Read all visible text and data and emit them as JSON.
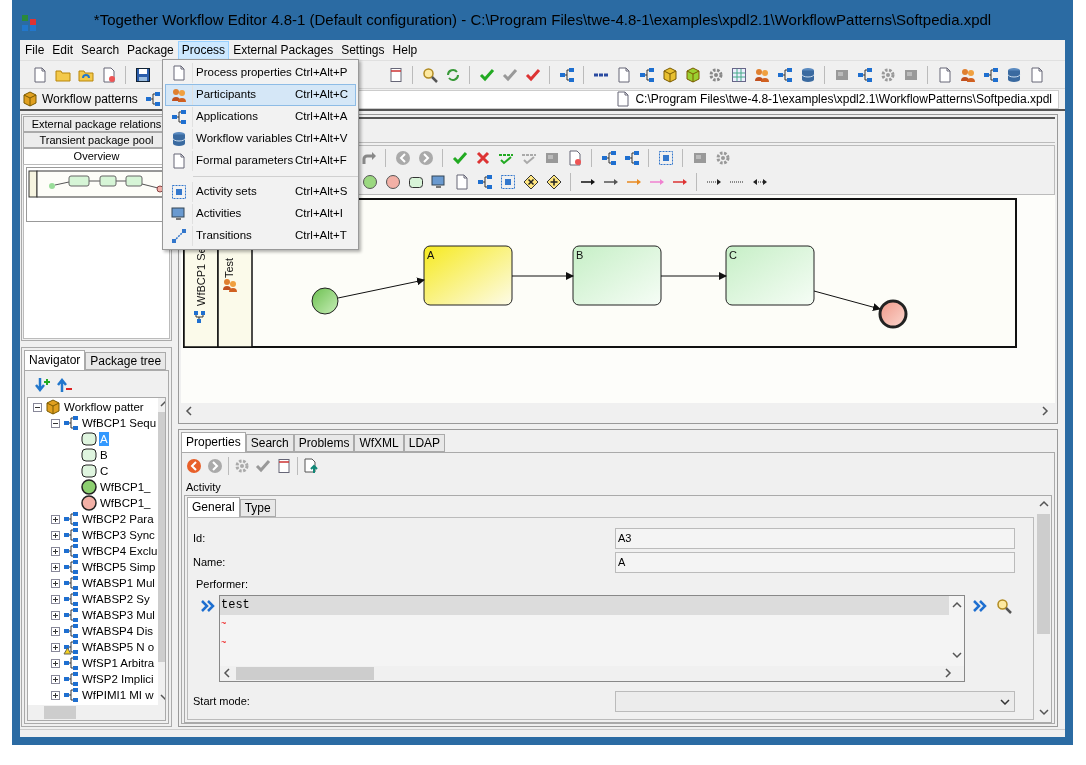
{
  "window": {
    "title": "*Together Workflow Editor 4.8-1 (Default configuration) - C:\\Program Files\\twe-4.8-1\\examples\\xpdl2.1\\WorkflowPatterns\\Softpedia.xpdl"
  },
  "menu_bar": [
    {
      "label": "File",
      "selected": false
    },
    {
      "label": "Edit",
      "selected": false
    },
    {
      "label": "Search",
      "selected": false
    },
    {
      "label": "Package",
      "selected": false
    },
    {
      "label": "Process",
      "selected": true
    },
    {
      "label": "External Packages",
      "selected": false
    },
    {
      "label": "Settings",
      "selected": false
    },
    {
      "label": "Help",
      "selected": false
    }
  ],
  "process_menu": {
    "groups": [
      [
        {
          "label": "Process properties",
          "shortcut": "Ctrl+Alt+P",
          "selected": false
        },
        {
          "label": "Participants",
          "shortcut": "Ctrl+Alt+C",
          "selected": true
        },
        {
          "label": "Applications",
          "shortcut": "Ctrl+Alt+A",
          "selected": false
        },
        {
          "label": "Workflow variables",
          "shortcut": "Ctrl+Alt+V",
          "selected": false
        },
        {
          "label": "Formal parameters",
          "shortcut": "Ctrl+Alt+F",
          "selected": false
        }
      ],
      [
        {
          "label": "Activity sets",
          "shortcut": "Ctrl+Alt+S",
          "selected": false
        },
        {
          "label": "Activities",
          "shortcut": "Ctrl+Alt+I",
          "selected": false
        },
        {
          "label": "Transitions",
          "shortcut": "Ctrl+Alt+T",
          "selected": false
        }
      ]
    ]
  },
  "package_bar": {
    "package": "Workflow patterns",
    "file_path": "C:\\Program Files\\twe-4.8-1\\examples\\xpdl2.1\\WorkflowPatterns\\Softpedia.xpdl"
  },
  "left_tabs": [
    {
      "label": "External package relations",
      "selected": false
    },
    {
      "label": "Transient package pool",
      "selected": false
    },
    {
      "label": "Overview",
      "selected": true
    }
  ],
  "navigator_tabs": [
    {
      "label": "Navigator",
      "selected": true
    },
    {
      "label": "Package tree",
      "selected": false
    }
  ],
  "tree": [
    {
      "label": "Workflow patter",
      "kind": "package",
      "expanded": true,
      "selected": false,
      "children": [
        {
          "label": "WfBCP1 Sequ",
          "kind": "process",
          "expanded": true,
          "selected": false,
          "children": [
            {
              "label": "A",
              "kind": "activity",
              "selected": true
            },
            {
              "label": "B",
              "kind": "activity",
              "selected": false
            },
            {
              "label": "C",
              "kind": "activity",
              "selected": false
            },
            {
              "label": "WfBCP1_",
              "kind": "start",
              "selected": false
            },
            {
              "label": "WfBCP1_",
              "kind": "end",
              "selected": false
            }
          ]
        },
        {
          "label": "WfBCP2 Para",
          "kind": "process",
          "expanded": false,
          "selected": false
        },
        {
          "label": "WfBCP3 Sync",
          "kind": "process",
          "expanded": false,
          "selected": false
        },
        {
          "label": "WfBCP4 Exclu",
          "kind": "process",
          "expanded": false,
          "selected": false
        },
        {
          "label": "WfBCP5 Simp",
          "kind": "process",
          "expanded": false,
          "selected": false
        },
        {
          "label": "WfABSP1 Mul",
          "kind": "process",
          "expanded": false,
          "selected": false
        },
        {
          "label": "WfABSP2 Sy",
          "kind": "process",
          "expanded": false,
          "selected": false
        },
        {
          "label": "WfABSP3 Mul",
          "kind": "process",
          "expanded": false,
          "selected": false
        },
        {
          "label": "WfABSP4 Dis",
          "kind": "process",
          "expanded": false,
          "selected": false
        },
        {
          "label": "WfABSP5 N o",
          "kind": "warning_process",
          "expanded": false,
          "selected": false
        },
        {
          "label": "WfSP1 Arbitra",
          "kind": "process",
          "expanded": false,
          "selected": false
        },
        {
          "label": "WfSP2 Implici",
          "kind": "process",
          "expanded": false,
          "selected": false
        },
        {
          "label": "WfPIMI1 MI w",
          "kind": "process",
          "expanded": false,
          "selected": false
        }
      ]
    }
  ],
  "diagram": {
    "lanes": [
      {
        "label": "WfBCP1 Se",
        "kind": "process"
      },
      {
        "label": "Test",
        "kind": "participant"
      }
    ],
    "nodes": [
      {
        "kind": "start"
      },
      {
        "kind": "activity",
        "label": "A",
        "selected": true
      },
      {
        "kind": "activity",
        "label": "B",
        "selected": false
      },
      {
        "kind": "activity",
        "label": "C",
        "selected": false
      },
      {
        "kind": "end"
      }
    ]
  },
  "properties": {
    "tabs": [
      {
        "label": "Properties",
        "selected": true
      },
      {
        "label": "Search",
        "selected": false
      },
      {
        "label": "Problems",
        "selected": false
      },
      {
        "label": "WfXML",
        "selected": false
      },
      {
        "label": "LDAP",
        "selected": false
      }
    ],
    "section": "Activity",
    "subtabs": [
      {
        "label": "General",
        "selected": true
      },
      {
        "label": "Type",
        "selected": false
      }
    ],
    "fields": [
      {
        "label": "Id:",
        "value": "A3"
      },
      {
        "label": "Name:",
        "value": "A"
      }
    ],
    "performer": {
      "label": "Performer:",
      "lines": [
        "test",
        "~",
        "~"
      ]
    },
    "start_mode": {
      "label": "Start mode:"
    }
  }
}
